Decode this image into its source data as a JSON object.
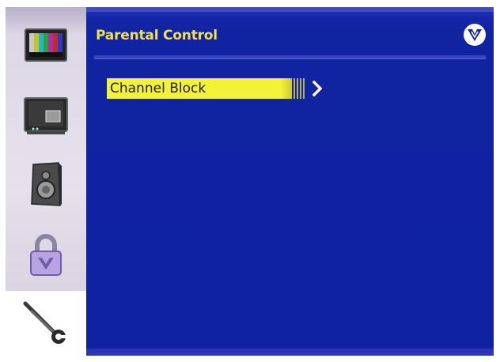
{
  "header": {
    "title": "Parental Control",
    "logo_icon": "vizio-v-logo-icon"
  },
  "sidebar": {
    "items": [
      {
        "name": "picture",
        "icon": "tv-color-bars-icon",
        "selected": false
      },
      {
        "name": "input",
        "icon": "monitor-pip-icon",
        "selected": false
      },
      {
        "name": "audio",
        "icon": "speaker-icon",
        "selected": false
      },
      {
        "name": "parental",
        "icon": "padlock-icon",
        "selected": false
      },
      {
        "name": "setup",
        "icon": "wrench-tools-icon",
        "selected": true
      }
    ]
  },
  "menu": {
    "items": [
      {
        "label": "Channel Block",
        "highlighted": true,
        "submenu_icon": "chevron-right-icon"
      }
    ]
  },
  "colors": {
    "background": "#0f1fa0",
    "title": "#f2e14a",
    "highlight": "#f4f236"
  }
}
